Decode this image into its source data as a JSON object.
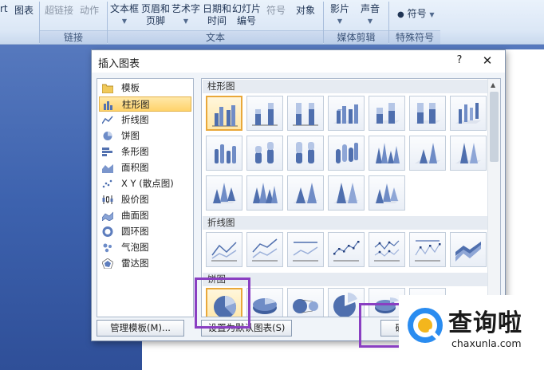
{
  "ribbon": {
    "items": {
      "smartart_partial": "rt",
      "chart": "图表",
      "hyperlink": "超链接",
      "action": "动作",
      "textbox": "文本框",
      "header_footer": "页眉和\n页脚",
      "wordart": "艺术字",
      "datetime": "日期和\n时间",
      "slide_number": "幻灯片\n编号",
      "symbol_obj": "符号",
      "object": "对象",
      "movie": "影片",
      "sound": "声音",
      "symbol": "符号"
    },
    "groups": {
      "links": "链接",
      "text": "文本",
      "media": "媒体剪辑",
      "special": "特殊符号"
    }
  },
  "dialog": {
    "title": "插入图表",
    "help": "?",
    "close": "✕",
    "categories": [
      {
        "label": "模板",
        "icon": "folder-icon"
      },
      {
        "label": "柱形图",
        "icon": "column-chart-icon",
        "selected": true
      },
      {
        "label": "折线图",
        "icon": "line-chart-icon"
      },
      {
        "label": "饼图",
        "icon": "pie-chart-icon"
      },
      {
        "label": "条形图",
        "icon": "bar-chart-icon"
      },
      {
        "label": "面积图",
        "icon": "area-chart-icon"
      },
      {
        "label": "X Y (散点图)",
        "icon": "scatter-chart-icon"
      },
      {
        "label": "股价图",
        "icon": "stock-chart-icon"
      },
      {
        "label": "曲面图",
        "icon": "surface-chart-icon"
      },
      {
        "label": "圆环图",
        "icon": "doughnut-chart-icon"
      },
      {
        "label": "气泡图",
        "icon": "bubble-chart-icon"
      },
      {
        "label": "雷达图",
        "icon": "radar-chart-icon"
      }
    ],
    "sections": {
      "column": "柱形图",
      "line": "折线图",
      "pie": "饼图"
    },
    "buttons": {
      "manage_templates": "管理模板(M)...",
      "set_default": "设置为默认图表(S)",
      "ok": "确定"
    }
  },
  "watermark": {
    "text": "查询啦",
    "url": "chaxunla.com"
  },
  "colors": {
    "highlight": "#8a3fc2",
    "selection": "#ffd36b",
    "chart_blue": "#4f6fae"
  }
}
